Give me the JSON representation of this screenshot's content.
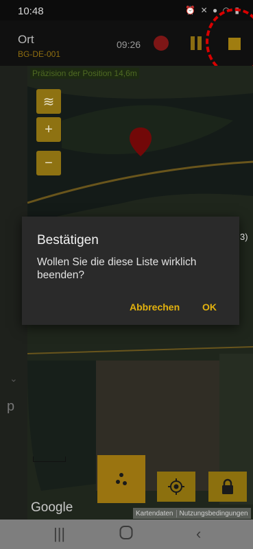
{
  "status_bar": {
    "time": "10:48",
    "icons": [
      "alarm-icon",
      "mute-icon",
      "location-icon",
      "wifi-icon",
      "battery-icon"
    ]
  },
  "header": {
    "title": "Ort",
    "subtitle": "BG-DE-001",
    "timer": "09:26",
    "icons": {
      "record": "record-dot-icon",
      "pause": "pause-icon",
      "stop": "stop-icon"
    }
  },
  "map": {
    "precision_text": "Präzision der Position 14,6m",
    "controls": [
      "layers-icon",
      "zoom-in-icon",
      "zoom-out-icon"
    ],
    "marker": "map-pin-icon",
    "left_panel_letter": "p",
    "partial_label": "3)",
    "google_logo": "Google",
    "attribution": [
      "Kartendaten",
      "Nutzungsbedingungen"
    ],
    "bottom_buttons": [
      "dots-menu-icon",
      "crosshair-icon",
      "lock-icon"
    ]
  },
  "dialog": {
    "title": "Bestätigen",
    "message": "Wollen Sie die diese Liste wirklich beenden?",
    "cancel_label": "Abbrechen",
    "ok_label": "OK"
  },
  "nav_bar": {
    "buttons": [
      "recents-icon",
      "home-icon",
      "back-icon"
    ]
  },
  "colors": {
    "accent": "#e3b20e",
    "button_bg": "#9a7410",
    "dialog_bg": "#2a2a2a",
    "highlight": "#d80000"
  }
}
